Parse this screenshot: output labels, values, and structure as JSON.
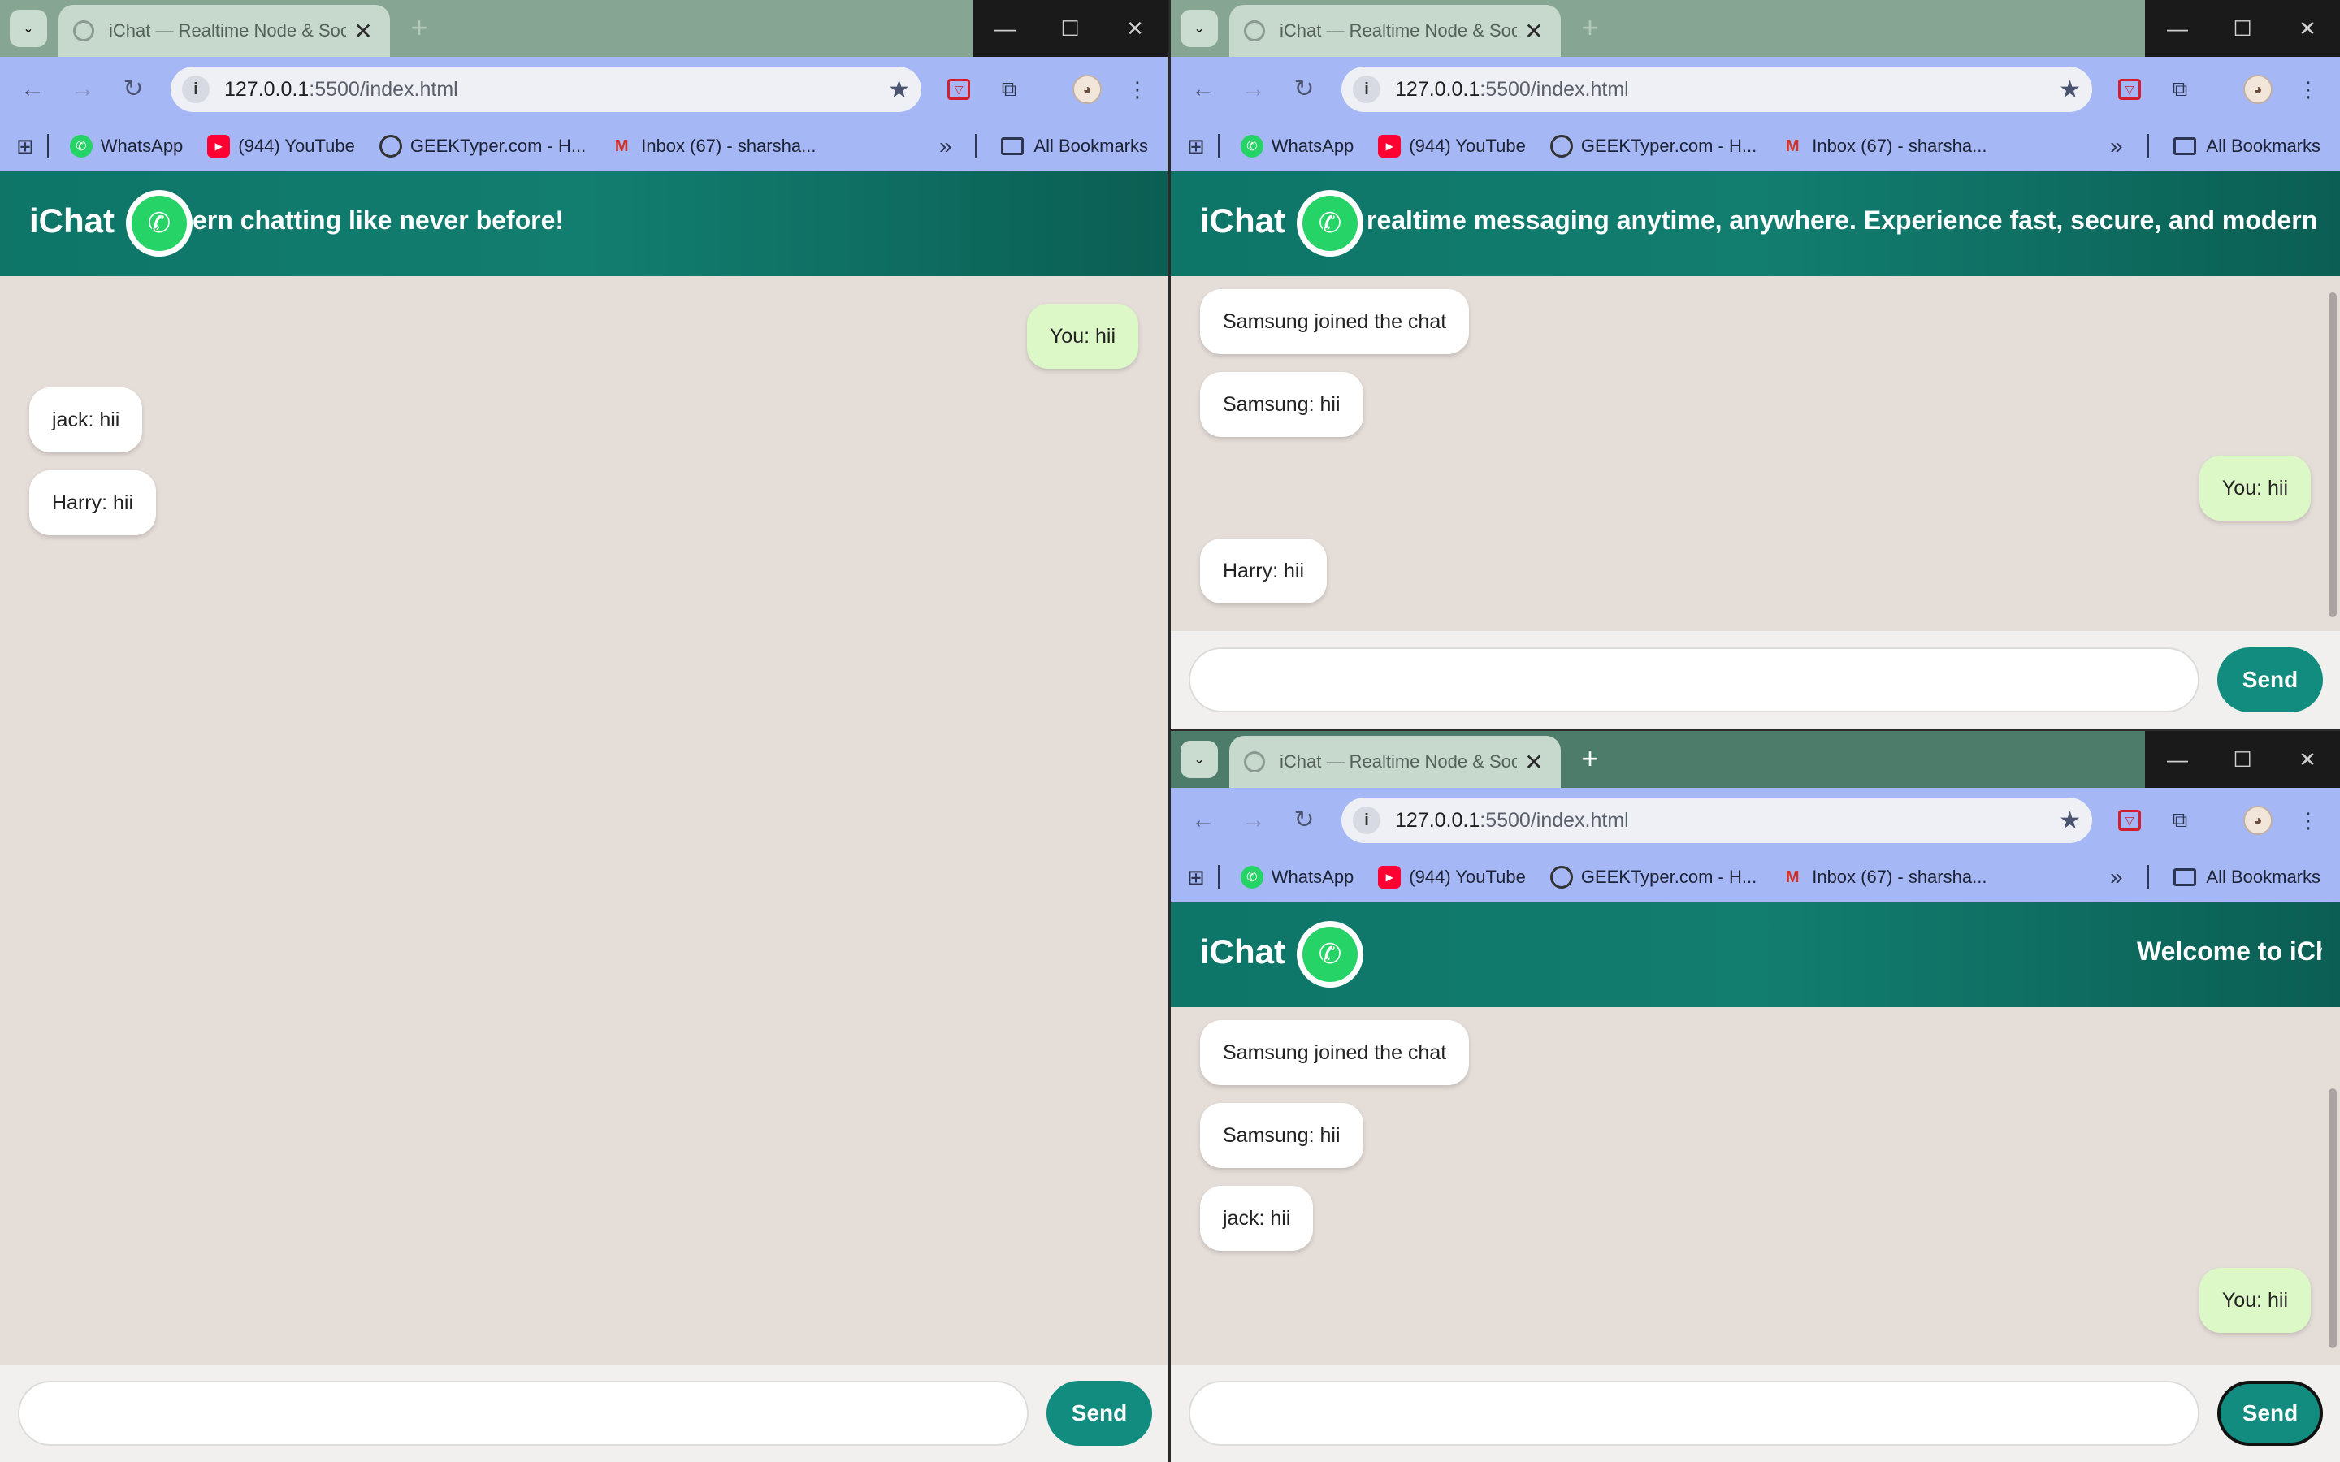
{
  "browser": {
    "tab_title": "iChat — Realtime Node & Socket",
    "tab_close": "✕",
    "new_tab": "+",
    "url_host": "127.0.0.1",
    "url_path": ":5500/index.html",
    "bookmarks": [
      {
        "label": "WhatsApp",
        "icon": "whatsapp-icon"
      },
      {
        "label": "(944) YouTube",
        "icon": "youtube-icon"
      },
      {
        "label": "GEEKTyper.com - H...",
        "icon": "globe-icon"
      },
      {
        "label": "Inbox (67) - sharsha...",
        "icon": "gmail-icon"
      }
    ],
    "all_bookmarks": "All Bookmarks",
    "more": "»"
  },
  "app": {
    "brand": "iChat",
    "marquee_w1": "ern chatting like never before!",
    "marquee_w2": "realtime messaging anytime, anywhere. Experience fast, secure, and modern cha",
    "marquee_w3": "Welcome to iCh",
    "send_label": "Send"
  },
  "windows": {
    "w1": {
      "messages": [
        {
          "text": "You: hii",
          "dir": "out"
        },
        {
          "text": "jack: hii",
          "dir": "in"
        },
        {
          "text": "Harry: hii",
          "dir": "in"
        }
      ]
    },
    "w2": {
      "messages": [
        {
          "text": "Samsung joined the chat",
          "dir": "in"
        },
        {
          "text": "Samsung: hii",
          "dir": "in"
        },
        {
          "text": "You: hii",
          "dir": "out"
        },
        {
          "text": "Harry: hii",
          "dir": "in"
        }
      ]
    },
    "w3": {
      "messages": [
        {
          "text": "Samsung joined the chat",
          "dir": "in"
        },
        {
          "text": "Samsung: hii",
          "dir": "in"
        },
        {
          "text": "jack: hii",
          "dir": "in"
        },
        {
          "text": "You: hii",
          "dir": "out"
        }
      ]
    }
  },
  "colors": {
    "header": "#0e7567",
    "send": "#128c7e",
    "bubble_out": "#dcf8c6",
    "bubble_in": "#ffffff",
    "chat_bg": "#e5ddd8"
  }
}
